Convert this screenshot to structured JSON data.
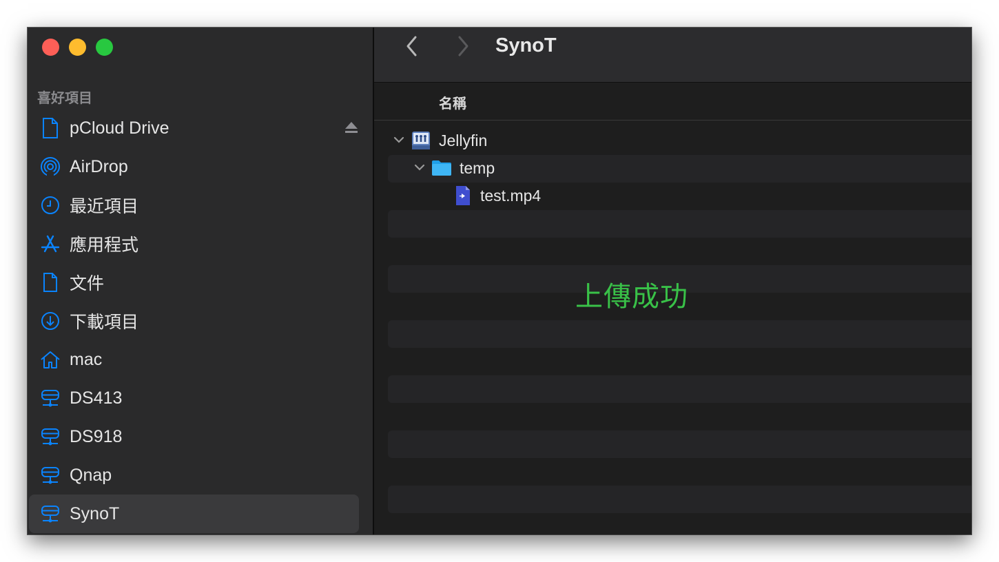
{
  "sidebar": {
    "section_title": "喜好項目",
    "items": [
      {
        "label": "pCloud Drive",
        "icon": "document-icon"
      },
      {
        "label": "AirDrop",
        "icon": "airdrop-icon"
      },
      {
        "label": "最近項目",
        "icon": "clock-icon"
      },
      {
        "label": "應用程式",
        "icon": "apps-icon"
      },
      {
        "label": "文件",
        "icon": "document-icon"
      },
      {
        "label": "下載項目",
        "icon": "download-icon"
      },
      {
        "label": "mac",
        "icon": "home-icon"
      },
      {
        "label": "DS413",
        "icon": "server-icon"
      },
      {
        "label": "DS918",
        "icon": "server-icon"
      },
      {
        "label": "Qnap",
        "icon": "server-icon"
      },
      {
        "label": "SynoT",
        "icon": "server-icon",
        "selected": true
      }
    ]
  },
  "toolbar": {
    "title": "SynoT"
  },
  "columns": {
    "name": "名稱"
  },
  "files": [
    {
      "name": "Jellyfin",
      "icon": "shared-volume-icon",
      "expanded": true
    },
    {
      "name": "temp",
      "icon": "folder-icon",
      "expanded": true
    },
    {
      "name": "test.mp4",
      "icon": "video-file-icon"
    }
  ],
  "overlay": {
    "message": "上傳成功"
  },
  "colors": {
    "accent": "#0a84ff",
    "success": "#39c148"
  }
}
